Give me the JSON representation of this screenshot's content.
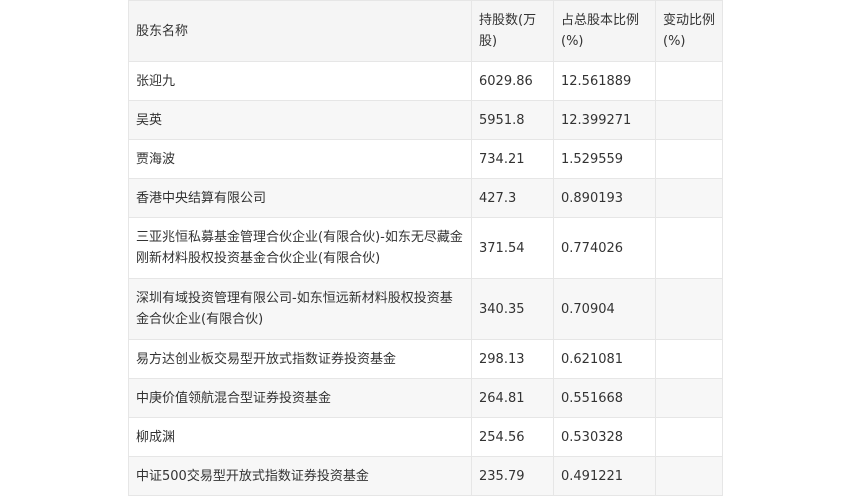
{
  "table": {
    "headers": [
      "股东名称",
      "持股数(万股)",
      "占总股本比例(%)",
      "变动比例(%)"
    ],
    "rows": [
      {
        "name": "张迎九",
        "shares": "6029.86",
        "ratio": "12.561889",
        "change": ""
      },
      {
        "name": "吴英",
        "shares": "5951.8",
        "ratio": "12.399271",
        "change": ""
      },
      {
        "name": "贾海波",
        "shares": "734.21",
        "ratio": "1.529559",
        "change": ""
      },
      {
        "name": "香港中央结算有限公司",
        "shares": "427.3",
        "ratio": "0.890193",
        "change": ""
      },
      {
        "name": "三亚兆恒私募基金管理合伙企业(有限合伙)-如东无尽藏金刚新材料股权投资基金合伙企业(有限合伙)",
        "shares": "371.54",
        "ratio": "0.774026",
        "change": ""
      },
      {
        "name": "深圳有域投资管理有限公司-如东恒远新材料股权投资基金合伙企业(有限合伙)",
        "shares": "340.35",
        "ratio": "0.70904",
        "change": ""
      },
      {
        "name": "易方达创业板交易型开放式指数证券投资基金",
        "shares": "298.13",
        "ratio": "0.621081",
        "change": ""
      },
      {
        "name": "中庚价值领航混合型证券投资基金",
        "shares": "264.81",
        "ratio": "0.551668",
        "change": ""
      },
      {
        "name": "柳成渊",
        "shares": "254.56",
        "ratio": "0.530328",
        "change": ""
      },
      {
        "name": "中证500交易型开放式指数证券投资基金",
        "shares": "235.79",
        "ratio": "0.491221",
        "change": ""
      }
    ]
  }
}
